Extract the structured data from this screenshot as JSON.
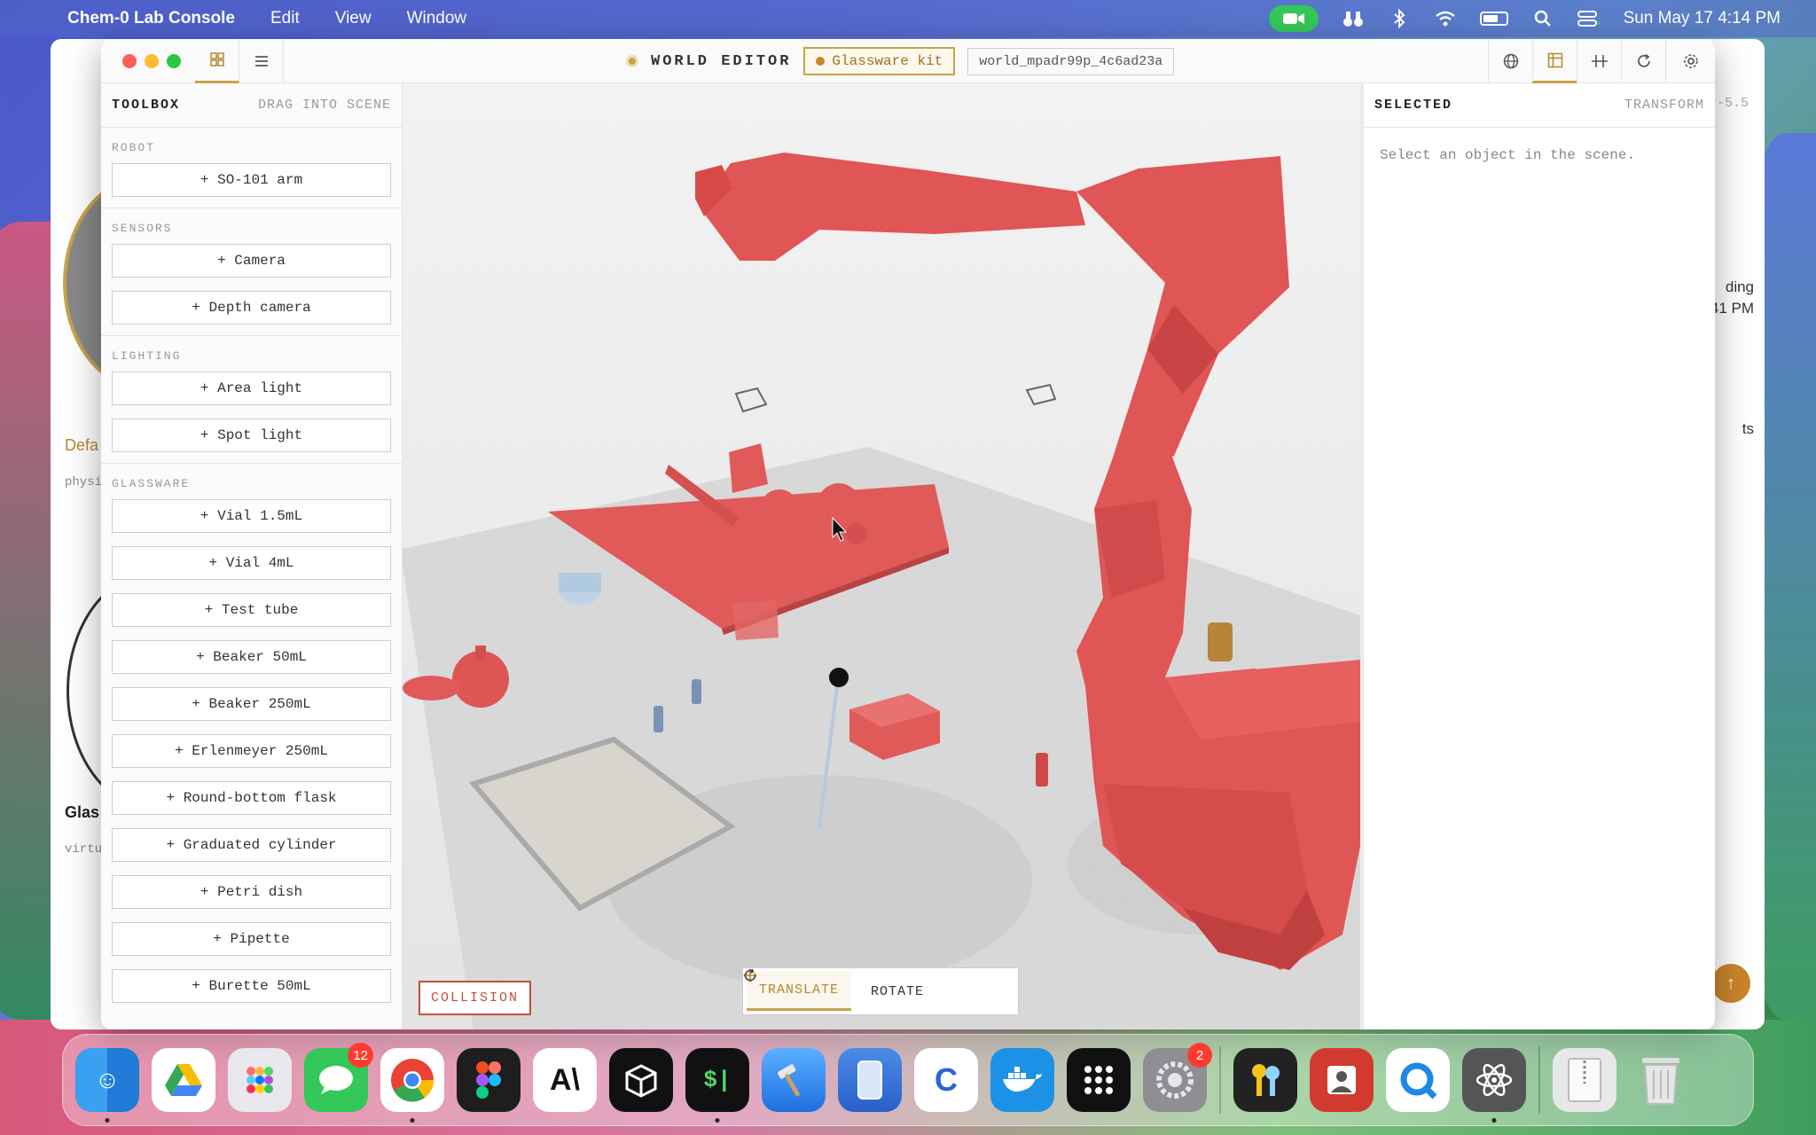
{
  "menubar": {
    "app_name": "Chem-0 Lab Console",
    "menus": [
      "Edit",
      "View",
      "Window"
    ],
    "clock": "Sun May 17  4:14 PM"
  },
  "back_window": {
    "text1": "Defa",
    "text2": "physi",
    "text3": "Glas",
    "text4": "virtu",
    "right1": "ding",
    "right2": "41 PM",
    "right3": "ts",
    "tab_text": "-5.5"
  },
  "titlebar": {
    "label": "WORLD EDITOR",
    "kit": "Glassware kit",
    "world_id": "world_mpadr99p_4c6ad23a"
  },
  "toolbox": {
    "title": "TOOLBOX",
    "hint": "DRAG INTO SCENE",
    "sections": [
      {
        "label": "ROBOT",
        "items": [
          "+ SO-101 arm"
        ]
      },
      {
        "label": "SENSORS",
        "items": [
          "+ Camera",
          "+ Depth camera"
        ]
      },
      {
        "label": "LIGHTING",
        "items": [
          "+ Area light",
          "+ Spot light"
        ]
      },
      {
        "label": "GLASSWARE",
        "items": [
          "+ Vial 1.5mL",
          "+ Vial 4mL",
          "+ Test tube",
          "+ Beaker 50mL",
          "+ Beaker 250mL",
          "+ Erlenmeyer 250mL",
          "+ Round-bottom flask",
          "+ Graduated cylinder",
          "+ Petri dish",
          "+ Pipette",
          "+ Burette 50mL"
        ]
      }
    ]
  },
  "viewport": {
    "collision": "COLLISION",
    "translate": "TRANSLATE",
    "rotate": "ROTATE"
  },
  "selected": {
    "title": "SELECTED",
    "tab": "TRANSFORM",
    "empty": "Select an object in the scene."
  },
  "dock": {
    "messages_badge": "12",
    "settings_badge": "2"
  },
  "colors": {
    "accent": "#c9a24a",
    "robot": "#e05555",
    "collision": "#c0503a"
  }
}
